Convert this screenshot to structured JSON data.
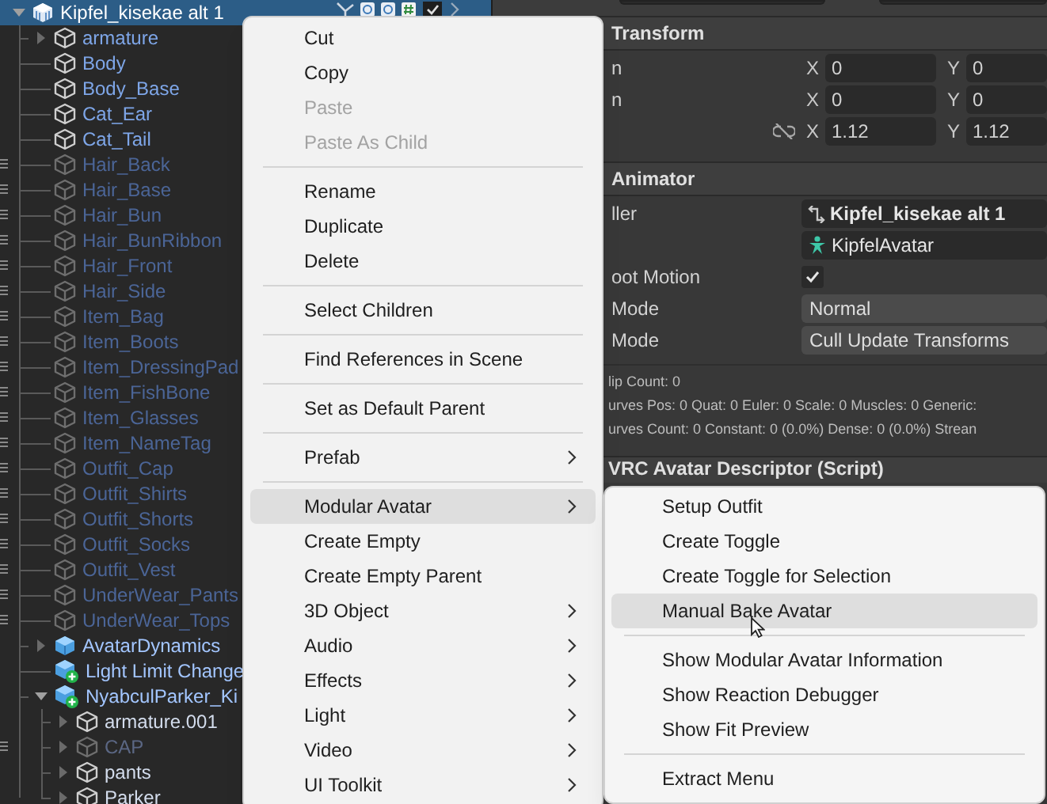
{
  "hierarchy": {
    "items": [
      {
        "label": "Kipfel_kisekae alt 1",
        "kind": "prefab_variant",
        "selected": true,
        "active": true,
        "expanded": true,
        "color": "#ffffff",
        "children": [
          {
            "label": "armature",
            "kind": "object",
            "selected": false,
            "active": true,
            "expanded": false,
            "color": "#7ea6e8"
          },
          {
            "label": "Body",
            "kind": "object",
            "selected": false,
            "active": true,
            "color": "#7ea6e8"
          },
          {
            "label": "Body_Base",
            "kind": "object",
            "selected": false,
            "active": true,
            "color": "#7ea6e8"
          },
          {
            "label": "Cat_Ear",
            "kind": "object",
            "selected": false,
            "active": true,
            "color": "#7ea6e8"
          },
          {
            "label": "Cat_Tail",
            "kind": "object",
            "selected": false,
            "active": true,
            "color": "#7ea6e8"
          },
          {
            "label": "Hair_Back",
            "kind": "object",
            "selected": false,
            "active": false,
            "color": "#4b6597"
          },
          {
            "label": "Hair_Base",
            "kind": "object",
            "selected": false,
            "active": false,
            "color": "#4b6597"
          },
          {
            "label": "Hair_Bun",
            "kind": "object",
            "selected": false,
            "active": false,
            "color": "#4b6597"
          },
          {
            "label": "Hair_BunRibbon",
            "kind": "object",
            "selected": false,
            "active": false,
            "color": "#4b6597"
          },
          {
            "label": "Hair_Front",
            "kind": "object",
            "selected": false,
            "active": false,
            "color": "#4b6597"
          },
          {
            "label": "Hair_Side",
            "kind": "object",
            "selected": false,
            "active": false,
            "color": "#4b6597"
          },
          {
            "label": "Item_Bag",
            "kind": "object",
            "selected": false,
            "active": false,
            "color": "#4b6597"
          },
          {
            "label": "Item_Boots",
            "kind": "object",
            "selected": false,
            "active": false,
            "color": "#4b6597"
          },
          {
            "label": "Item_DressingPad",
            "kind": "object",
            "selected": false,
            "active": false,
            "color": "#4b6597"
          },
          {
            "label": "Item_FishBone",
            "kind": "object",
            "selected": false,
            "active": false,
            "color": "#4b6597"
          },
          {
            "label": "Item_Glasses",
            "kind": "object",
            "selected": false,
            "active": false,
            "color": "#4b6597"
          },
          {
            "label": "Item_NameTag",
            "kind": "object",
            "selected": false,
            "active": false,
            "color": "#4b6597"
          },
          {
            "label": "Outfit_Cap",
            "kind": "object",
            "selected": false,
            "active": false,
            "color": "#4b6597"
          },
          {
            "label": "Outfit_Shirts",
            "kind": "object",
            "selected": false,
            "active": false,
            "color": "#4b6597"
          },
          {
            "label": "Outfit_Shorts",
            "kind": "object",
            "selected": false,
            "active": false,
            "color": "#4b6597"
          },
          {
            "label": "Outfit_Socks",
            "kind": "object",
            "selected": false,
            "active": false,
            "color": "#4b6597"
          },
          {
            "label": "Outfit_Vest",
            "kind": "object",
            "selected": false,
            "active": false,
            "color": "#4b6597"
          },
          {
            "label": "UnderWear_Pants",
            "kind": "object",
            "selected": false,
            "active": false,
            "color": "#4b6597"
          },
          {
            "label": "UnderWear_Tops",
            "kind": "object",
            "selected": false,
            "active": false,
            "color": "#4b6597"
          },
          {
            "label": "AvatarDynamics",
            "kind": "prefab",
            "selected": false,
            "active": true,
            "expanded": false,
            "color": "#a3c6ff"
          },
          {
            "label": "Light Limit Change",
            "kind": "prefab_added",
            "selected": false,
            "active": true,
            "color": "#a3c6ff"
          },
          {
            "label": "NyabculParker_Ki",
            "kind": "prefab_added",
            "selected": false,
            "active": true,
            "expanded": true,
            "color": "#a3c6ff",
            "children": [
              {
                "label": "armature.001",
                "kind": "object",
                "selected": false,
                "active": true,
                "expanded": false,
                "color": "#d3dcec"
              },
              {
                "label": "CAP",
                "kind": "object",
                "selected": false,
                "active": false,
                "expanded": false,
                "color": "#5b6784"
              },
              {
                "label": "pants",
                "kind": "object",
                "selected": false,
                "active": true,
                "expanded": false,
                "color": "#d3dcec"
              },
              {
                "label": "Parker",
                "kind": "object",
                "selected": false,
                "active": true,
                "expanded": false,
                "color": "#d3dcec"
              }
            ]
          }
        ]
      }
    ]
  },
  "inspector": {
    "transform": {
      "title": "Transform",
      "rows": [
        {
          "label": "n",
          "fields": [
            {
              "axis": "X",
              "value": "0"
            },
            {
              "axis": "Y",
              "value": "0"
            }
          ]
        },
        {
          "label": "n",
          "fields": [
            {
              "axis": "X",
              "value": "0"
            },
            {
              "axis": "Y",
              "value": "0"
            }
          ]
        },
        {
          "kind": "scale",
          "fields": [
            {
              "axis": "X",
              "value": "1.12"
            },
            {
              "axis": "Y",
              "value": "1.12"
            }
          ]
        }
      ]
    },
    "animator": {
      "title": "Animator",
      "rows": [
        {
          "kind": "controller",
          "label": "ller",
          "value": "Kipfel_kisekae alt 1"
        },
        {
          "kind": "avatar",
          "value": "KipfelAvatar"
        },
        {
          "kind": "checkbox",
          "label": "oot Motion",
          "checked": true
        },
        {
          "kind": "dropdown",
          "label": "Mode",
          "value": "Normal"
        },
        {
          "kind": "dropdown",
          "label": "Mode",
          "value": "Cull Update Transforms"
        }
      ],
      "info": [
        "lip Count: 0",
        "urves Pos: 0 Quat: 0 Euler: 0 Scale: 0 Muscles: 0 Generic:",
        "urves Count: 0 Constant: 0 (0.0%) Dense: 0 (0.0%) Strean"
      ]
    },
    "next_component": {
      "title": "VRC Avatar Descriptor (Script)"
    }
  },
  "context_menu": {
    "items": [
      {
        "kind": "item",
        "label": "Cut",
        "disabled": false
      },
      {
        "kind": "item",
        "label": "Copy",
        "disabled": false
      },
      {
        "kind": "item",
        "label": "Paste",
        "disabled": true
      },
      {
        "kind": "item",
        "label": "Paste As Child",
        "disabled": true
      },
      {
        "kind": "separator"
      },
      {
        "kind": "item",
        "label": "Rename",
        "disabled": false
      },
      {
        "kind": "item",
        "label": "Duplicate",
        "disabled": false
      },
      {
        "kind": "item",
        "label": "Delete",
        "disabled": false
      },
      {
        "kind": "separator"
      },
      {
        "kind": "item",
        "label": "Select Children",
        "disabled": false
      },
      {
        "kind": "separator"
      },
      {
        "kind": "item",
        "label": "Find References in Scene",
        "disabled": false
      },
      {
        "kind": "separator"
      },
      {
        "kind": "item",
        "label": "Set as Default Parent",
        "disabled": false
      },
      {
        "kind": "separator"
      },
      {
        "kind": "item",
        "label": "Prefab",
        "submenu": true
      },
      {
        "kind": "separator"
      },
      {
        "kind": "item",
        "label": "Modular Avatar",
        "submenu": true,
        "selected": true
      },
      {
        "kind": "item",
        "label": "Create Empty"
      },
      {
        "kind": "item",
        "label": "Create Empty Parent"
      },
      {
        "kind": "item",
        "label": "3D Object",
        "submenu": true
      },
      {
        "kind": "item",
        "label": "Audio",
        "submenu": true
      },
      {
        "kind": "item",
        "label": "Effects",
        "submenu": true
      },
      {
        "kind": "item",
        "label": "Light",
        "submenu": true
      },
      {
        "kind": "item",
        "label": "Video",
        "submenu": true
      },
      {
        "kind": "item",
        "label": "UI Toolkit",
        "submenu": true
      }
    ]
  },
  "submenu": {
    "items": [
      {
        "kind": "item",
        "label": "Setup Outfit",
        "selected": false
      },
      {
        "kind": "item",
        "label": "Create Toggle",
        "selected": false
      },
      {
        "kind": "item",
        "label": "Create Toggle for Selection",
        "selected": false
      },
      {
        "kind": "item",
        "label": "Manual Bake Avatar",
        "selected": true
      },
      {
        "kind": "separator"
      },
      {
        "kind": "item",
        "label": "Show Modular Avatar Information",
        "selected": false
      },
      {
        "kind": "item",
        "label": "Show Reaction Debugger",
        "selected": false
      },
      {
        "kind": "item",
        "label": "Show Fit Preview",
        "selected": false
      },
      {
        "kind": "separator"
      },
      {
        "kind": "item",
        "label": "Extract Menu",
        "selected": false
      }
    ]
  }
}
